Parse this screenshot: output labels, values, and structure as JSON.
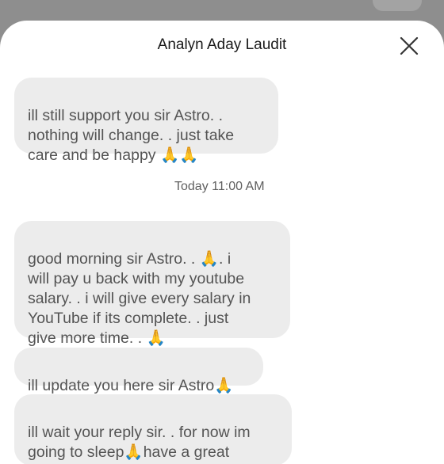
{
  "conversation": {
    "contact_name": "Analyn Aday Laudit",
    "close_icon": "close-icon"
  },
  "messages": [
    {
      "text": "ill still support you sir Astro. .\nnothing will change. .  just take\ncare and be happy 🙏🙏"
    },
    {
      "text": "good morning sir Astro. .  🙏.  i\nwill pay u back with my youtube\nsalary. .  i will give every salary in\nYouTube if its complete. .  just\ngive more time. .  🙏"
    },
    {
      "text": "ill update you here sir Astro🙏"
    },
    {
      "text": "ill wait your reply sir. .  for now im\ngoing to sleep🙏have a great"
    }
  ],
  "timestamp": "Today 11:00 AM",
  "colors": {
    "bubble": "#ececec",
    "text": "#545454",
    "backdrop": "#8e8e8e"
  }
}
